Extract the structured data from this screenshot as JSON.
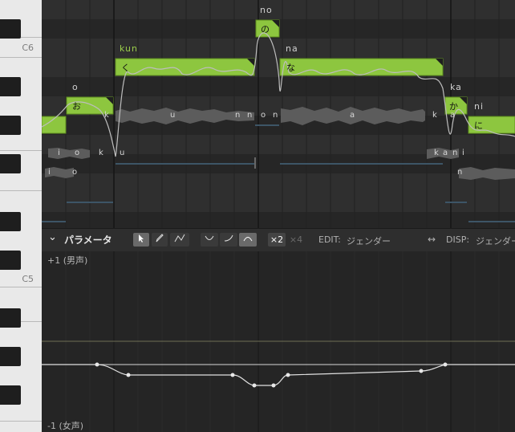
{
  "keyboard": {
    "labels": [
      "C6",
      "C5"
    ]
  },
  "notes": [
    {
      "lyric": "",
      "phoneme": ""
    },
    {
      "lyric": "お",
      "phoneme": "o"
    },
    {
      "lyric": "く",
      "phoneme": "kun"
    },
    {
      "lyric": "の",
      "phoneme": "no"
    },
    {
      "lyric": "な",
      "phoneme": "na"
    },
    {
      "lyric": "か",
      "phoneme": "ka"
    },
    {
      "lyric": "に",
      "phoneme": "ni"
    }
  ],
  "phoneme_track_a": [
    "k",
    "u",
    "n",
    "n",
    "o",
    "n",
    "a",
    "k",
    "a"
  ],
  "phoneme_track_b": [
    "i",
    "o",
    "k",
    "u",
    "k",
    "a",
    "n",
    "i"
  ],
  "phoneme_track_c": [
    "i",
    "o",
    "n"
  ],
  "param_panel": {
    "title": "パラメータ",
    "tools": [
      "select",
      "pencil",
      "line"
    ],
    "curve_tools": [
      "v-curve",
      "up-curve",
      "hump-curve"
    ],
    "zoom_x2": "×2",
    "zoom_x4": "×4",
    "edit_label": "EDIT:",
    "edit_value": "ジェンダー",
    "arrows": "↔",
    "disp_label": "DISP:",
    "disp_value": "ジェンダー",
    "top_label": "+1 (男声)",
    "bottom_label": "-1 (女声)"
  },
  "colors": {
    "note_fill": "#8dc63f",
    "note_stroke": "#5e8f1f",
    "kun_label": "#9acd4a",
    "background": "#2b2b2b"
  }
}
